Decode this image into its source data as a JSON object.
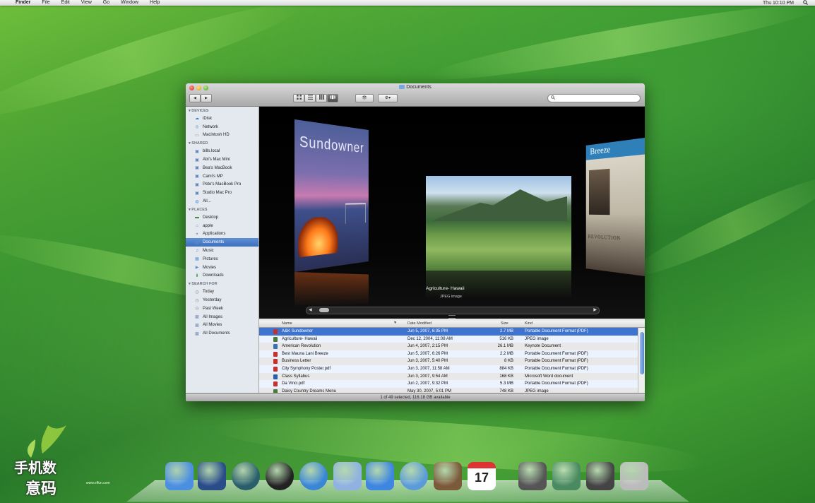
{
  "menubar": {
    "apple_glyph": "",
    "items": [
      "Finder",
      "File",
      "Edit",
      "View",
      "Go",
      "Window",
      "Help"
    ],
    "clock": "Thu 10:10 PM"
  },
  "window": {
    "title": "Documents",
    "back_glyph": "◀",
    "forward_glyph": "▶",
    "view_buttons": [
      "icon-view",
      "list-view",
      "column-view",
      "coverflow-view"
    ],
    "quicklook_glyph": "👁",
    "action_glyph": "⚙▾",
    "search": {
      "placeholder": "",
      "value": ""
    },
    "status": "1 of 49 selected, 116.18 GB available"
  },
  "sidebar": {
    "sections": [
      {
        "header": "DEVICES",
        "items": [
          {
            "label": "iDisk",
            "icon": "idisk-icon"
          },
          {
            "label": "Network",
            "icon": "network-icon"
          },
          {
            "label": "Macintosh HD",
            "icon": "harddrive-icon"
          }
        ]
      },
      {
        "header": "SHARED",
        "items": [
          {
            "label": "bills.local",
            "icon": "computer-icon"
          },
          {
            "label": "Abi's Mac Mini",
            "icon": "computer-icon"
          },
          {
            "label": "Bea's MacBook",
            "icon": "computer-icon"
          },
          {
            "label": "Cami's MP",
            "icon": "computer-icon"
          },
          {
            "label": "Pete's MacBook Pro",
            "icon": "computer-icon"
          },
          {
            "label": "Studio Mac Pro",
            "icon": "computer-icon"
          },
          {
            "label": "All...",
            "icon": "globe-icon"
          }
        ]
      },
      {
        "header": "PLACES",
        "items": [
          {
            "label": "Desktop",
            "icon": "desktop-icon"
          },
          {
            "label": "apple",
            "icon": "home-icon"
          },
          {
            "label": "Applications",
            "icon": "applications-icon"
          },
          {
            "label": "Documents",
            "icon": "documents-icon",
            "selected": true
          },
          {
            "label": "Music",
            "icon": "music-icon"
          },
          {
            "label": "Pictures",
            "icon": "pictures-icon"
          },
          {
            "label": "Movies",
            "icon": "movies-icon"
          },
          {
            "label": "Downloads",
            "icon": "downloads-icon"
          }
        ]
      },
      {
        "header": "SEARCH FOR",
        "items": [
          {
            "label": "Today",
            "icon": "clock-icon"
          },
          {
            "label": "Yesterday",
            "icon": "clock-icon"
          },
          {
            "label": "Past Week",
            "icon": "clock-icon"
          },
          {
            "label": "All Images",
            "icon": "smart-folder-icon"
          },
          {
            "label": "All Movies",
            "icon": "smart-folder-icon"
          },
          {
            "label": "All Documents",
            "icon": "smart-folder-icon"
          }
        ]
      }
    ]
  },
  "coverflow": {
    "covers": {
      "left_title": "Sundowner",
      "right_title": "Breeze",
      "right_subtitle": "REVOLUTION"
    },
    "caption": "Agriculture- Hawaii",
    "caption_kind": "JPEG image"
  },
  "list": {
    "columns": [
      "Name",
      "Date Modified",
      "Size",
      "Kind"
    ],
    "rows": [
      {
        "name": "A&K Sundowner",
        "date": "Jun 5, 2007, 6:35 PM",
        "size": "2.7 MB",
        "kind": "Portable Document Format (PDF)",
        "icon_color": "#c9302c",
        "selected": true
      },
      {
        "name": "Agriculture- Hawaii",
        "date": "Dec 12, 2004, 11:08 AM",
        "size": "516 KB",
        "kind": "JPEG image",
        "icon_color": "#4a7a3a"
      },
      {
        "name": "American Revolution",
        "date": "Jun 4, 2007, 2:15 PM",
        "size": "26.1 MB",
        "kind": "Keynote Document",
        "icon_color": "#3b6fb6"
      },
      {
        "name": "Best Mauna Lani Breeze",
        "date": "Jun 5, 2007, 6:26 PM",
        "size": "2.2 MB",
        "kind": "Portable Document Format (PDF)",
        "icon_color": "#c9302c"
      },
      {
        "name": "Business Letter",
        "date": "Jun 3, 2007, 5:40 PM",
        "size": "8 KB",
        "kind": "Portable Document Format (PDF)",
        "icon_color": "#c9302c"
      },
      {
        "name": "City Symphony Poster.pdf",
        "date": "Jun 3, 2007, 11:58 AM",
        "size": "884 KB",
        "kind": "Portable Document Format (PDF)",
        "icon_color": "#c9302c"
      },
      {
        "name": "Class Syllabus",
        "date": "Jun 3, 2007, 9:54 AM",
        "size": "168 KB",
        "kind": "Microsoft Word document",
        "icon_color": "#2a5db0"
      },
      {
        "name": "Da Vinci.pdf",
        "date": "Jun 2, 2007, 9:32 PM",
        "size": "5.3 MB",
        "kind": "Portable Document Format (PDF)",
        "icon_color": "#c9302c"
      },
      {
        "name": "Daisy Country Dreams Menu",
        "date": "May 30, 2007, 5:01 PM",
        "size": "748 KB",
        "kind": "JPEG image",
        "icon_color": "#4a7a3a"
      }
    ]
  },
  "dock": {
    "items": [
      {
        "name": "finder-icon",
        "color": "#4b8fe0"
      },
      {
        "name": "dashboard-icon",
        "color": "#2a4d8a"
      },
      {
        "name": "time-machine-icon",
        "color": "#2a5f6a"
      },
      {
        "name": "front-row-icon",
        "color": "#222"
      },
      {
        "name": "safari-icon",
        "color": "#3a86d6"
      },
      {
        "name": "preview-icon",
        "color": "#8fb2e0"
      },
      {
        "name": "ichat-icon",
        "color": "#3f86e0"
      },
      {
        "name": "itunes-icon",
        "color": "#5b9bd8"
      },
      {
        "name": "iphoto-icon",
        "color": "#7b5a3a"
      },
      {
        "name": "ical-icon",
        "color": "#ffffff"
      },
      {
        "name": "stack-documents-icon",
        "color": "#555"
      },
      {
        "name": "stack-pictures-icon",
        "color": "#4a8a60"
      },
      {
        "name": "stack-downloads-icon",
        "color": "#444"
      },
      {
        "name": "trash-icon",
        "color": "#bbbbbb"
      }
    ],
    "ical_date": "17"
  },
  "watermark": {
    "logo_text_top": "手机数",
    "logo_text_bottom": "意码",
    "url": "www.elfun.com"
  }
}
